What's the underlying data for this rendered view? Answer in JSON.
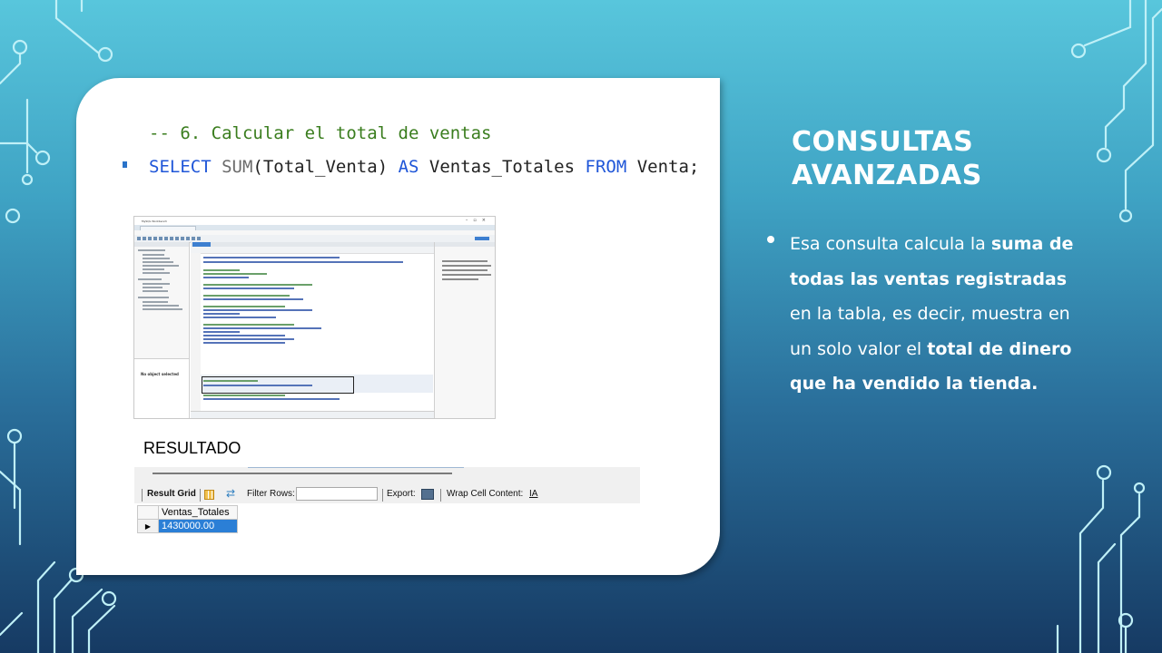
{
  "slide": {
    "title_line1": "CONSULTAS",
    "title_line2": "AVANZADAS",
    "body": [
      {
        "text": "Esa consulta calcula la ",
        "bold": false
      },
      {
        "text": "suma de todas las ventas registradas",
        "bold": true
      },
      {
        "text": " en la tabla, es decir, muestra en un solo valor el ",
        "bold": false
      },
      {
        "text": "total de dinero que ha vendido la tienda.",
        "bold": true
      }
    ]
  },
  "code": {
    "comment": "-- 6. Calcular el total de ventas",
    "select": "SELECT",
    "sum": "SUM",
    "args": "(Total_Venta) ",
    "as": "AS",
    "alias": " Ventas_Totales ",
    "from": "FROM",
    "table": " Venta;"
  },
  "workbench_thumb": {
    "title": "MySQL Workbench",
    "info_text": "No object selected"
  },
  "result": {
    "label": "RESULTADO",
    "toolbar": {
      "result_grid": "Result Grid",
      "filter_rows": "Filter Rows:",
      "export": "Export:",
      "wrap": "Wrap Cell Content:",
      "wrap_icon": "IA"
    },
    "column": "Ventas_Totales",
    "row_marker": "▶",
    "value": "1430000.00"
  },
  "colors": {
    "keyword": "#1f56d8",
    "comment": "#3a7d1e",
    "selected_cell": "#2b7fd6"
  }
}
